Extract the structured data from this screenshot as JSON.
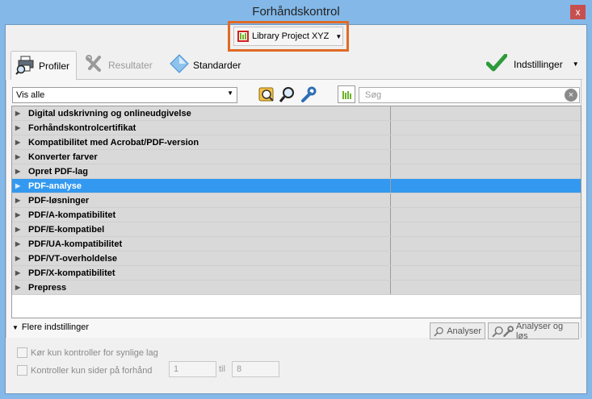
{
  "window": {
    "title": "Forhåndskontrol",
    "close_glyph": "x"
  },
  "library": {
    "label": "Library Project XYZ",
    "icon": "library-chart-icon",
    "accent": "#e06a25"
  },
  "tabs": [
    {
      "label": "Profiler",
      "icon": "printer-magnifier-icon",
      "active": true
    },
    {
      "label": "Resultater",
      "icon": "wrench-cross-icon",
      "active": false
    },
    {
      "label": "Standarder",
      "icon": "diamond-icon",
      "active": false
    }
  ],
  "settings": {
    "label": "Indstillinger",
    "icon": "green-check-icon"
  },
  "filter": {
    "selected": "Vis alle"
  },
  "search": {
    "placeholder": "Søg"
  },
  "categories": [
    "Digital udskrivning og onlineudgivelse",
    "Forhåndskontrolcertifikat",
    "Kompatibilitet med Acrobat/PDF-version",
    "Konverter farver",
    "Opret PDF-lag",
    "PDF-analyse",
    "PDF-løsninger",
    "PDF/A-kompatibilitet",
    "PDF/E-kompatibel",
    "PDF/UA-kompatibilitet",
    "PDF/VT-overholdelse",
    "PDF/X-kompatibilitet",
    "Prepress"
  ],
  "selected_category": "PDF-analyse",
  "more_settings": {
    "label": "Flere indstillinger"
  },
  "buttons": {
    "analyze": "Analyser",
    "analyze_fix": "Analyser og løs"
  },
  "options": {
    "visible_layers": "Kør kun kontroller for synlige lag",
    "pages_label": "Kontroller kun sider på forhånd",
    "from": "1",
    "til_label": "til",
    "to": "8"
  },
  "colors": {
    "selection": "#3399f0",
    "title_bar": "#83b8e8",
    "close": "#c7504f"
  }
}
